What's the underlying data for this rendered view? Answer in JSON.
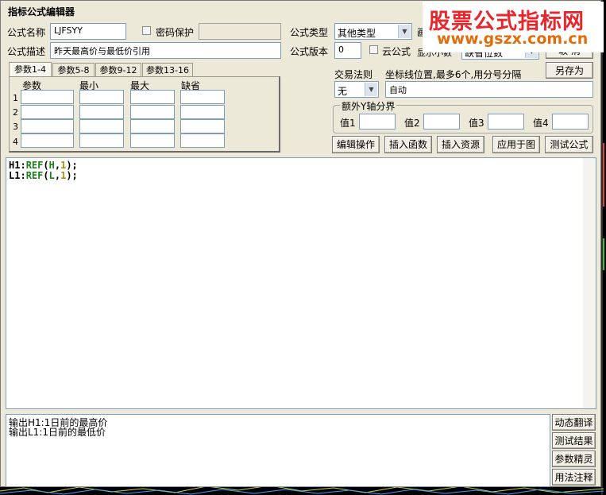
{
  "window": {
    "title": "指标公式编辑器"
  },
  "watermark": {
    "line1": "股票公式指标网",
    "line2": "www.gszx.com.cn"
  },
  "form": {
    "name_label": "公式名称",
    "name_value": "LJFSYY",
    "password_label": "密码保护",
    "desc_label": "公式描述",
    "desc_value": "昨天最高价与最低价引用",
    "type_label": "公式类型",
    "type_value": "其他类型",
    "draw_label": "画",
    "version_label": "公式版本",
    "version_value": "0",
    "cloud_label": "云公式",
    "decimal_label": "显示小数",
    "decimal_value": "缺省位数"
  },
  "buttons": {
    "cancel": "取 消",
    "save_as": "另存为",
    "edit_ops": "编辑操作",
    "insert_func": "插入函数",
    "insert_resource": "插入资源",
    "apply_chart": "应用于图",
    "test_formula": "测试公式",
    "dynamic_translate": "动态翻译",
    "test_result": "测试结果",
    "param_wizard": "参数精灵",
    "usage_notes": "用法注释"
  },
  "tabs": [
    "参数1-4",
    "参数5-8",
    "参数9-12",
    "参数13-16"
  ],
  "params": {
    "headers": [
      "参数",
      "最小",
      "最大",
      "缺省"
    ],
    "rows": [
      "1",
      "2",
      "3",
      "4"
    ]
  },
  "trade": {
    "rule_label": "交易法则",
    "rule_value": "无",
    "axis_label": "坐标线位置,最多6个,用分号分隔",
    "axis_value": "自动"
  },
  "extra_axis": {
    "title": "额外Y轴分界",
    "labels": [
      "值1",
      "值2",
      "值3",
      "值4"
    ]
  },
  "code_lines": [
    {
      "name": "H1",
      "func": "REF",
      "arg": "H",
      "num": "1"
    },
    {
      "name": "L1",
      "func": "REF",
      "arg": "L",
      "num": "1"
    }
  ],
  "output_lines": [
    "输出H1:1日前的最高价",
    "输出L1:1日前的最低价"
  ],
  "colors": {
    "bg_chart": "#000000",
    "watermark_red": "#e8262d",
    "watermark_orange": "#e36c0a",
    "code_func": "#1a7f1a",
    "code_num": "#b8860b"
  }
}
